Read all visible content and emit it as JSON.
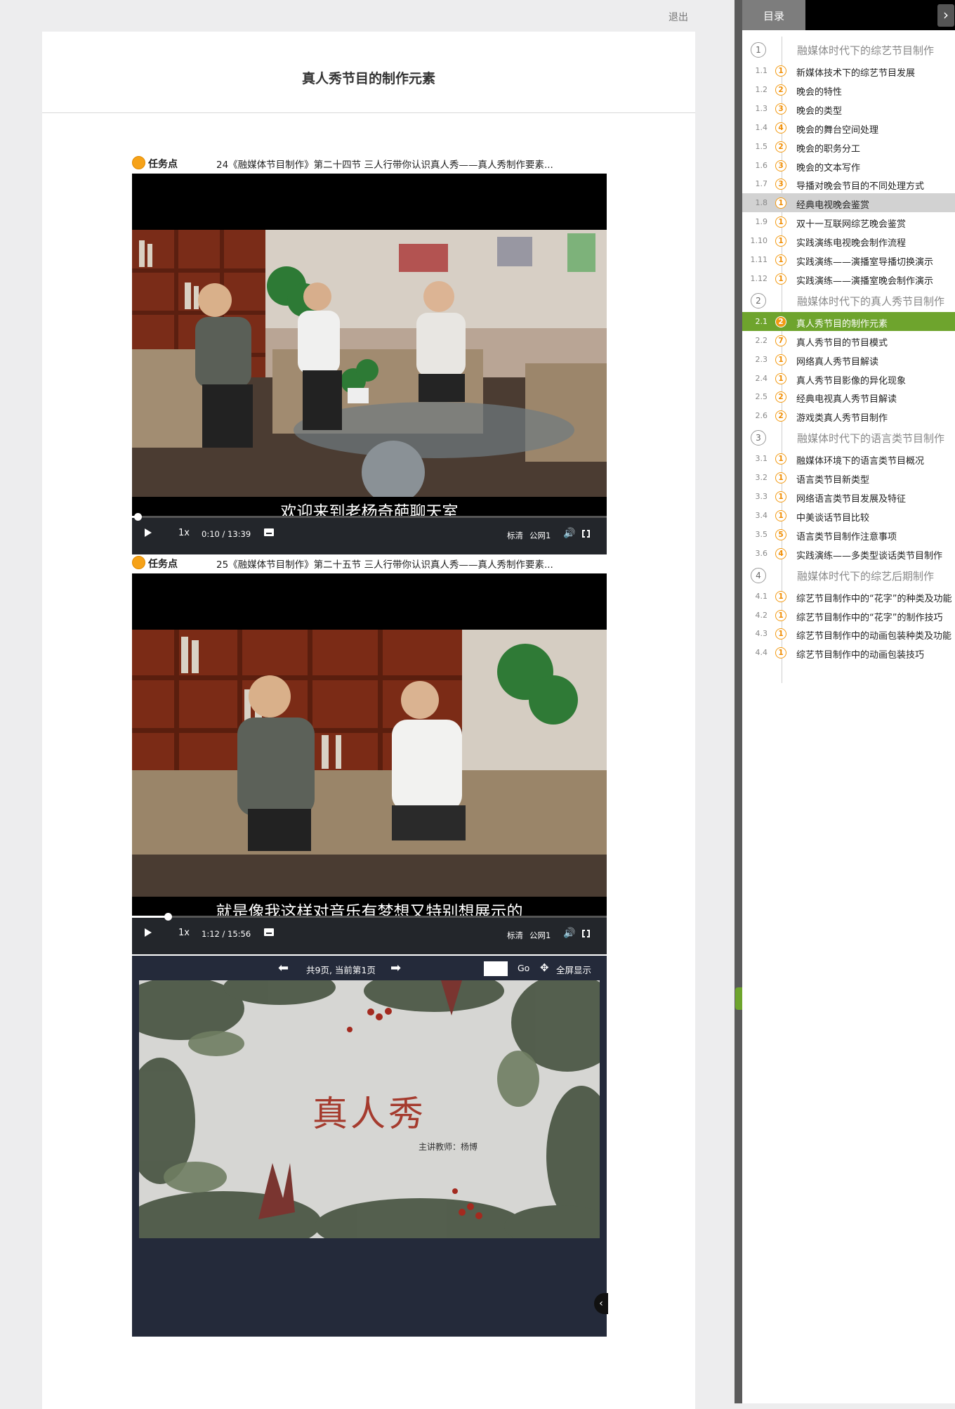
{
  "header": {
    "logout": "退出"
  },
  "page": {
    "title": "真人秀节目的制作元素"
  },
  "tasks": [
    {
      "label": "任务点",
      "desc": "24《融媒体节目制作》第二十四节 三人行带你认识真人秀——真人秀制作要素...",
      "subtitle": "欢迎来到老杨奇葩聊天室",
      "speed": "1x",
      "time": "0:10 / 13:39",
      "progress": 0.012,
      "quality": "标清",
      "line": "公网1"
    },
    {
      "label": "任务点",
      "desc": "25《融媒体节目制作》第二十五节 三人行带你认识真人秀——真人秀制作要素...",
      "subtitle": "就是像我这样对音乐有梦想又特别想展示的",
      "speed": "1x",
      "time": "1:12 / 15:56",
      "progress": 0.075,
      "quality": "标清",
      "line": "公网1"
    }
  ],
  "slides": {
    "page_info": "共9页, 当前第1页",
    "go": "Go",
    "fullscreen": "全屏显示",
    "title": "真人秀",
    "subtitle": "主讲教师：杨博"
  },
  "sidebar": {
    "tab": "目录",
    "chapters": [
      {
        "num": "1",
        "title": "融媒体时代下的综艺节目制作",
        "sections": [
          {
            "num": "1.1",
            "badge": "1",
            "title": "新媒体技术下的综艺节目发展"
          },
          {
            "num": "1.2",
            "badge": "2",
            "title": "晚会的特性"
          },
          {
            "num": "1.3",
            "badge": "3",
            "title": "晚会的类型"
          },
          {
            "num": "1.4",
            "badge": "4",
            "title": "晚会的舞台空间处理"
          },
          {
            "num": "1.5",
            "badge": "2",
            "title": "晚会的职务分工"
          },
          {
            "num": "1.6",
            "badge": "3",
            "title": "晚会的文本写作"
          },
          {
            "num": "1.7",
            "badge": "3",
            "title": "导播对晚会节目的不同处理方式"
          },
          {
            "num": "1.8",
            "badge": "1",
            "title": "经典电视晚会鉴赏"
          },
          {
            "num": "1.9",
            "badge": "1",
            "title": "双十一互联网综艺晚会鉴赏"
          },
          {
            "num": "1.10",
            "badge": "1",
            "title": "实践演练电视晚会制作流程"
          },
          {
            "num": "1.11",
            "badge": "1",
            "title": "实践演练——演播室导播切换演示"
          },
          {
            "num": "1.12",
            "badge": "1",
            "title": "实践演练——演播室晚会制作演示"
          }
        ]
      },
      {
        "num": "2",
        "title": "融媒体时代下的真人秀节目制作",
        "sections": [
          {
            "num": "2.1",
            "badge": "2",
            "title": "真人秀节目的制作元素"
          },
          {
            "num": "2.2",
            "badge": "7",
            "title": "真人秀节目的节目模式"
          },
          {
            "num": "2.3",
            "badge": "1",
            "title": "网络真人秀节目解读"
          },
          {
            "num": "2.4",
            "badge": "1",
            "title": "真人秀节目影像的异化现象"
          },
          {
            "num": "2.5",
            "badge": "2",
            "title": "经典电视真人秀节目解读"
          },
          {
            "num": "2.6",
            "badge": "2",
            "title": "游戏类真人秀节目制作"
          }
        ]
      },
      {
        "num": "3",
        "title": "融媒体时代下的语言类节目制作",
        "sections": [
          {
            "num": "3.1",
            "badge": "1",
            "title": "融媒体环境下的语言类节目概况"
          },
          {
            "num": "3.2",
            "badge": "1",
            "title": "语言类节目新类型"
          },
          {
            "num": "3.3",
            "badge": "1",
            "title": "网络语言类节目发展及特征"
          },
          {
            "num": "3.4",
            "badge": "1",
            "title": "中美谈话节目比较"
          },
          {
            "num": "3.5",
            "badge": "5",
            "title": "语言类节目制作注意事项"
          },
          {
            "num": "3.6",
            "badge": "4",
            "title": "实践演练——多类型谈话类节目制作"
          }
        ]
      },
      {
        "num": "4",
        "title": "融媒体时代下的综艺后期制作",
        "sections": [
          {
            "num": "4.1",
            "badge": "1",
            "title": "综艺节目制作中的“花字”的种类及功能"
          },
          {
            "num": "4.2",
            "badge": "1",
            "title": "综艺节目制作中的“花字”的制作技巧"
          },
          {
            "num": "4.3",
            "badge": "1",
            "title": "综艺节目制作中的动画包装种类及功能"
          },
          {
            "num": "4.4",
            "badge": "1",
            "title": "综艺节目制作中的动画包装技巧"
          }
        ]
      }
    ]
  }
}
